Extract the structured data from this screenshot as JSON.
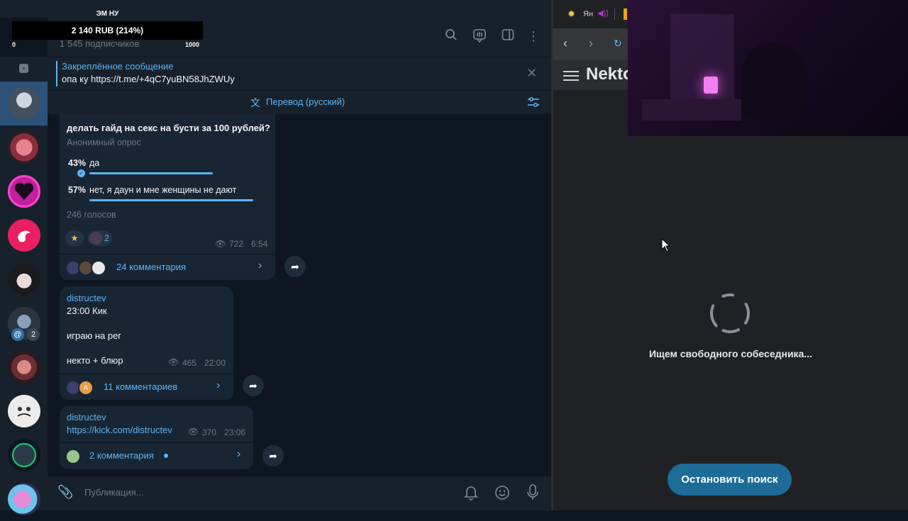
{
  "streamer_overlay": {
    "name": "ЭМ НУ",
    "amount": "2 140 RUB (214%)",
    "min": "0",
    "max": "1000",
    "progress_fraction": 1.0
  },
  "channel": {
    "subscribers": "1 545 подписчиков"
  },
  "pinned": {
    "title": "Закреплённое сообщение",
    "text": "опа ку https://t.me/+4qC7yuBN58JhZWUy"
  },
  "translate": {
    "label": "Перевод (русский)"
  },
  "sidebar": {
    "badges": [
      {
        "index": 5,
        "at": "@",
        "count": "2"
      }
    ]
  },
  "messages": [
    {
      "poll_question": "делать гайд на секс на бусти за 100 рублей?",
      "poll_type": "Анонимный опрос",
      "options": [
        {
          "percent": "43%",
          "label": "да",
          "fraction": 0.43,
          "chosen": true
        },
        {
          "percent": "57%",
          "label": "нет, я даун и мне женщины не дают",
          "fraction": 0.57,
          "chosen": false
        }
      ],
      "votes": "246 голосов",
      "reaction_count": "2",
      "views": "722",
      "time": "6:54",
      "comments": "24 комментария"
    },
    {
      "author": "distructev",
      "lines": [
        "23:00 Кик",
        "",
        "играю на рег",
        "",
        "некто + блюр"
      ],
      "line1": "23:00 Кик",
      "line2": "играю на рег",
      "line3": "некто + блюр",
      "views": "465",
      "time": "22:00",
      "comments": "11 комментариев",
      "comment_avatar_letter": "A"
    },
    {
      "author": "distructev",
      "link": "https://kick.com/distructev",
      "views": "370",
      "time": "23:06",
      "comments": "2 комментария"
    }
  ],
  "composer": {
    "placeholder": "Публикация..."
  },
  "browser": {
    "tab_label": "Ян",
    "site_title": "Nekto",
    "status": "Ищем свободного собеседника...",
    "stop_button": "Остановить поиск"
  },
  "colors": {
    "accent": "#5eb5f7",
    "bubble": "#182533",
    "background": "#0e1621",
    "stop_button": "#1d6c97"
  }
}
